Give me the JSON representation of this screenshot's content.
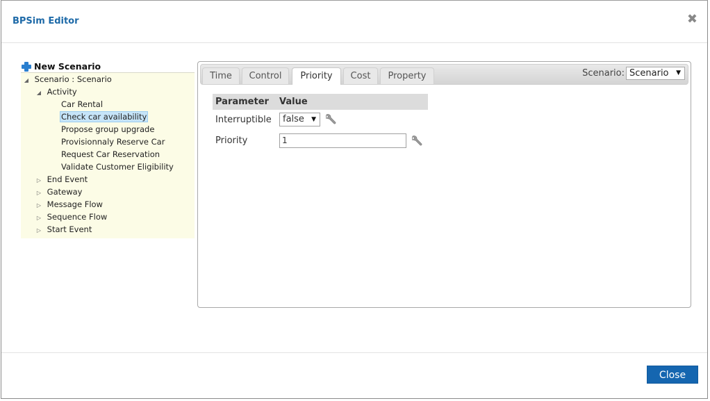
{
  "dialog": {
    "title": "BPSim Editor",
    "close_icon": "close-x-icon",
    "close_button_label": "Close"
  },
  "tree": {
    "new_scenario_label": "New Scenario",
    "new_scenario_icon": "plus-icon",
    "root": {
      "label": "Scenario : Scenario",
      "expanded": true,
      "groups": [
        {
          "label": "Activity",
          "expanded": true,
          "children": [
            {
              "label": "Car Rental",
              "selected": false
            },
            {
              "label": "Check car availability",
              "selected": true
            },
            {
              "label": "Propose group upgrade",
              "selected": false
            },
            {
              "label": "Provisionnaly Reserve Car",
              "selected": false
            },
            {
              "label": "Request Car Reservation",
              "selected": false
            },
            {
              "label": "Validate Customer Eligibility",
              "selected": false
            }
          ]
        },
        {
          "label": "End Event",
          "expanded": false
        },
        {
          "label": "Gateway",
          "expanded": false
        },
        {
          "label": "Message Flow",
          "expanded": false
        },
        {
          "label": "Sequence Flow",
          "expanded": false
        },
        {
          "label": "Start Event",
          "expanded": false
        }
      ]
    }
  },
  "tabs": [
    {
      "label": "Time",
      "active": false
    },
    {
      "label": "Control",
      "active": false
    },
    {
      "label": "Priority",
      "active": true
    },
    {
      "label": "Cost",
      "active": false
    },
    {
      "label": "Property",
      "active": false
    }
  ],
  "scenario_selector": {
    "label": "Scenario:",
    "value": "Scenario"
  },
  "parameters": {
    "headers": [
      "Parameter",
      "Value"
    ],
    "rows": [
      {
        "name": "Interruptible",
        "type": "select",
        "value": "false",
        "icon": "wrench-icon"
      },
      {
        "name": "Priority",
        "type": "text",
        "value": "1",
        "icon": "wrench-icon"
      }
    ]
  },
  "colors": {
    "title": "#1e6aa8",
    "primary_button": "#1566b0",
    "tree_background": "#fcfce6",
    "selected_node": "#c6e4f8"
  }
}
